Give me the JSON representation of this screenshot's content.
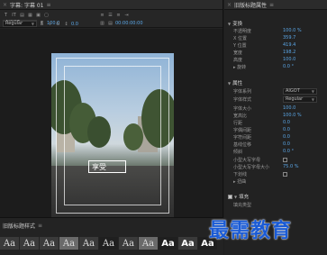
{
  "left_panel": {
    "title": "字幕: 字幕 01",
    "toolbar": {
      "font": "AIGOT",
      "style": "Regular",
      "size_value": "100.0",
      "leading_value": "0.0",
      "timecode": "00:00:00:00"
    }
  },
  "caption": {
    "text": "享受"
  },
  "bottom_panel": {
    "title": "旧版标题样式",
    "swatch_label": "Aa"
  },
  "right_panel": {
    "title": "旧版标题属性",
    "transform": {
      "header": "变换",
      "rows": [
        {
          "label": "不透明度",
          "value": "100.0 %"
        },
        {
          "label": "X 位置",
          "value": "359.7"
        },
        {
          "label": "Y 位置",
          "value": "419.4"
        },
        {
          "label": "宽度",
          "value": "198.2"
        },
        {
          "label": "高度",
          "value": "100.0"
        },
        {
          "label": "▸ 旋转",
          "value": "0.0 °"
        }
      ]
    },
    "properties": {
      "header": "属性",
      "font_family_label": "字体系列",
      "font_family_value": "AIGOT",
      "font_style_label": "字体样式",
      "font_style_value": "Regular",
      "rows": [
        {
          "label": "字体大小",
          "value": "100.0"
        },
        {
          "label": "宽高比",
          "value": "100.0 %"
        },
        {
          "label": "行距",
          "value": "0.0"
        },
        {
          "label": "字偶间距",
          "value": "0.0"
        },
        {
          "label": "字符间距",
          "value": "0.0"
        },
        {
          "label": "基线位移",
          "value": "0.0"
        },
        {
          "label": "倾斜",
          "value": "0.0 °"
        }
      ],
      "small_caps_label": "小型大写字母",
      "small_caps_size_label": "小型大写字母大小",
      "small_caps_size_value": "75.0 %",
      "underline_label": "下划线",
      "distort_label": "▸ 扭曲"
    },
    "fill": {
      "header": "填充",
      "fill_type_label": "填充类型"
    }
  },
  "watermark": "最需教育",
  "colors": {
    "accent": "#5aa6e6",
    "watermark": "#1a5bd6"
  }
}
